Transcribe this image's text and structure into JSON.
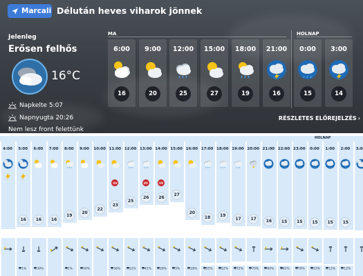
{
  "header": {
    "location_button": "Marcali",
    "headline": "Délután heves viharok jönnek"
  },
  "current": {
    "label": "Jelenleg",
    "condition": "Erősen felhős",
    "icon": "cloudy-icon",
    "temp": "16°C",
    "sunrise": "Napkelte 5:07",
    "sunset": "Napnyugta 20:26",
    "front_note": "Nem lesz front felettünk"
  },
  "hourly_section": {
    "today_label": "MA",
    "tomorrow_label": "HOLNAP",
    "detail_link": "RÉSZLETES ELŐREJELZÉS"
  },
  "hourly": [
    {
      "time": "6:00",
      "icon": "partly-cloudy-icon",
      "temp": "16"
    },
    {
      "time": "9:00",
      "icon": "sunny-cloud-icon",
      "temp": "20"
    },
    {
      "time": "12:00",
      "icon": "rain-cloud-icon",
      "temp": "25"
    },
    {
      "time": "15:00",
      "icon": "sunny-cloud-icon",
      "temp": "27"
    },
    {
      "time": "18:00",
      "icon": "sun-rain-icon",
      "temp": "19"
    },
    {
      "time": "21:00",
      "icon": "night-storm-icon",
      "temp": "16"
    },
    {
      "time": "0:00",
      "icon": "night-rain-icon",
      "temp": "15"
    },
    {
      "time": "3:00",
      "icon": "night-storm-icon",
      "temp": "14"
    }
  ],
  "strip": {
    "tomorrow_label": "HOLNAP",
    "uv_label": "UV",
    "columns": [
      {
        "time": "4:00",
        "icon": "night-cloud-icon",
        "temp": "",
        "bolt": true,
        "uv": false,
        "wind_dir": "right",
        "rain": "",
        "bar": 0.22,
        "precip": 0.0
      },
      {
        "time": "5:00",
        "icon": "night-cloud-icon",
        "temp": "16",
        "bolt": true,
        "uv": false,
        "wind_dir": "down",
        "rain": "1%",
        "bar": 0.26,
        "precip": 0.0
      },
      {
        "time": "6:00",
        "icon": "partly-cloudy-icon",
        "temp": "16",
        "bolt": false,
        "uv": false,
        "wind_dir": "down",
        "rain": "30%",
        "bar": 0.26,
        "precip": 0.0
      },
      {
        "time": "7:00",
        "icon": "partly-cloudy-icon",
        "temp": "16",
        "bolt": false,
        "uv": false,
        "wind_dir": "up-right",
        "rain": "",
        "bar": 0.26,
        "precip": 0.0
      },
      {
        "time": "8:00",
        "icon": "sun-rain-icon",
        "temp": "19",
        "bolt": false,
        "uv": false,
        "wind_dir": "down-right",
        "rain": "1%",
        "bar": 0.36,
        "precip": 0.0
      },
      {
        "time": "9:00",
        "icon": "partly-cloudy-icon",
        "temp": "20",
        "bolt": false,
        "uv": false,
        "wind_dir": "down-right",
        "rain": "30%",
        "bar": 0.44,
        "precip": 0.0
      },
      {
        "time": "10:00",
        "icon": "sunny-cloud-icon",
        "temp": "22",
        "bolt": false,
        "uv": false,
        "wind_dir": "down-right",
        "rain": "",
        "bar": 0.52,
        "precip": 0.0
      },
      {
        "time": "11:00",
        "icon": "sunny-cloud-icon",
        "temp": "23",
        "bolt": false,
        "uv": true,
        "wind_dir": "down-right",
        "rain": "36%",
        "bar": 0.62,
        "precip": 0.0
      },
      {
        "time": "12:00",
        "icon": "rain-cloud-icon",
        "temp": "25",
        "bolt": false,
        "uv": false,
        "wind_dir": "down-right",
        "rain": "12%",
        "bar": 0.72,
        "precip": 0.0
      },
      {
        "time": "13:00",
        "icon": "rain-cloud-icon",
        "temp": "26",
        "bolt": false,
        "uv": true,
        "wind_dir": "down-right",
        "rain": "41%",
        "bar": 0.8,
        "precip": 0.0
      },
      {
        "time": "14:00",
        "icon": "sunny-cloud-icon",
        "temp": "26",
        "bolt": false,
        "uv": true,
        "wind_dir": "down-right",
        "rain": "28%",
        "bar": 0.8,
        "precip": 0.0
      },
      {
        "time": "15:00",
        "icon": "sunny-cloud-icon",
        "temp": "27",
        "bolt": false,
        "uv": false,
        "wind_dir": "down-right",
        "rain": "5%",
        "bar": 0.86,
        "precip": 0.0
      },
      {
        "time": "16:00",
        "icon": "sunny-cloud-icon",
        "temp": "20",
        "bolt": false,
        "uv": false,
        "wind_dir": "down-right",
        "rain": "28%",
        "bar": 0.44,
        "precip": 0.0
      },
      {
        "time": "17:00",
        "icon": "rain-cloud-icon",
        "temp": "18",
        "bolt": false,
        "uv": false,
        "wind_dir": "down-right",
        "rain": "35%",
        "bar": 0.32,
        "precip": 0.2
      },
      {
        "time": "18:00",
        "icon": "rain-cloud-icon",
        "temp": "19",
        "bolt": false,
        "uv": false,
        "wind_dir": "down-right",
        "rain": "22%",
        "bar": 0.36,
        "precip": 0.2
      },
      {
        "time": "19:00",
        "icon": "rain-cloud-icon",
        "temp": "17",
        "bolt": false,
        "uv": false,
        "wind_dir": "down-right",
        "rain": "72%",
        "bar": 0.28,
        "precip": 0.3
      },
      {
        "time": "20:00",
        "icon": "storm-cloud-icon",
        "temp": "17",
        "bolt": false,
        "uv": false,
        "wind_dir": "up",
        "rain": "70%",
        "bar": 0.28,
        "precip": 0.3
      },
      {
        "time": "21:00",
        "icon": "night-rain-icon",
        "temp": "16",
        "bolt": false,
        "uv": false,
        "wind_dir": "right",
        "rain": "60%",
        "bar": 0.24,
        "precip": 0.2
      },
      {
        "time": "22:00",
        "icon": "night-rain-icon",
        "temp": "15",
        "bolt": false,
        "uv": false,
        "wind_dir": "right",
        "rain": "61%",
        "bar": 0.22,
        "precip": 0.2
      },
      {
        "time": "23:00",
        "icon": "night-rain-icon",
        "temp": "15",
        "bolt": false,
        "uv": false,
        "wind_dir": "down-right",
        "rain": "70%",
        "bar": 0.22,
        "precip": 0.2
      },
      {
        "time": "0:00",
        "icon": "night-rain-icon",
        "temp": "15",
        "bolt": false,
        "uv": false,
        "wind_dir": "down-right",
        "rain": "23%",
        "bar": 0.2,
        "precip": 0.2
      },
      {
        "time": "1:00",
        "icon": "night-rain-icon",
        "temp": "15",
        "bolt": false,
        "uv": false,
        "wind_dir": "up",
        "rain": "12%",
        "bar": 0.2,
        "precip": 0.1
      },
      {
        "time": "2:00",
        "icon": "night-rain-icon",
        "temp": "15",
        "bolt": false,
        "uv": false,
        "wind_dir": "up",
        "rain": "12%",
        "bar": 0.2,
        "precip": 0.1
      },
      {
        "time": "3:00",
        "icon": "night-cloud-icon",
        "temp": "",
        "bolt": false,
        "uv": false,
        "wind_dir": "up",
        "rain": "",
        "bar": 0.18,
        "precip": 0.0
      }
    ]
  },
  "colors": {
    "accent": "#3d7bd8",
    "uv": "#c8252b",
    "strip_bg": "#d8e9f9"
  }
}
